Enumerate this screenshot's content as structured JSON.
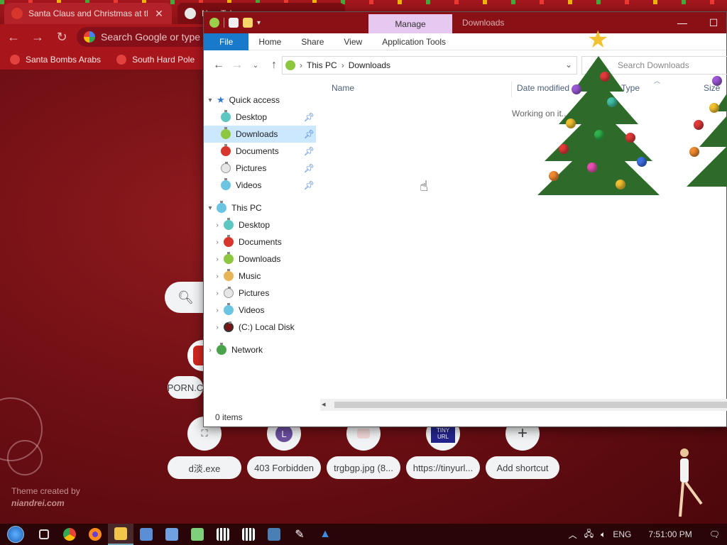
{
  "chrome": {
    "tabs": [
      {
        "title": "Santa Claus and Christmas at th",
        "close": "✕"
      },
      {
        "title": "New Tab",
        "close": ""
      }
    ],
    "omnibox_placeholder": "Search Google or type",
    "bookmarks": [
      "Santa Bombs Arabs",
      "South Hard Pole"
    ],
    "ntp": {
      "tile_labels": [
        "PORN.C",
        "d淡.exe",
        "403 Forbidden",
        "trgbgp.jpg (8...",
        "https://tinyurl...",
        "Add shortcut"
      ],
      "circle_glyphs": [
        "L",
        "TINY URL",
        "+"
      ],
      "credit_line1": "Theme created by",
      "credit_line2": "niandrei.com"
    }
  },
  "explorer": {
    "window_title": "Downloads",
    "contextual_tab": "Manage",
    "ribbon_tabs": [
      "File",
      "Home",
      "Share",
      "View",
      "Application Tools"
    ],
    "breadcrumb": [
      "This PC",
      "Downloads"
    ],
    "search_placeholder": "Search Downloads",
    "nav": {
      "quick_access": "Quick access",
      "quick_items": [
        "Desktop",
        "Downloads",
        "Documents",
        "Pictures",
        "Videos"
      ],
      "this_pc": "This PC",
      "pc_items": [
        "Desktop",
        "Documents",
        "Downloads",
        "Music",
        "Pictures",
        "Videos",
        "(C:) Local Disk"
      ],
      "network": "Network",
      "selected": "Downloads"
    },
    "columns": [
      "Name",
      "Date modified",
      "Type",
      "Size"
    ],
    "working_text": "Working on it...",
    "status": "0 items"
  },
  "taskbar": {
    "language": "ENG",
    "time": "7:51:00 PM"
  },
  "colors": {
    "accent_file_tab": "#1979ca",
    "manage_tab": "#e7c8f0",
    "selection": "#cce8ff",
    "title_bar": "#8b1016"
  }
}
